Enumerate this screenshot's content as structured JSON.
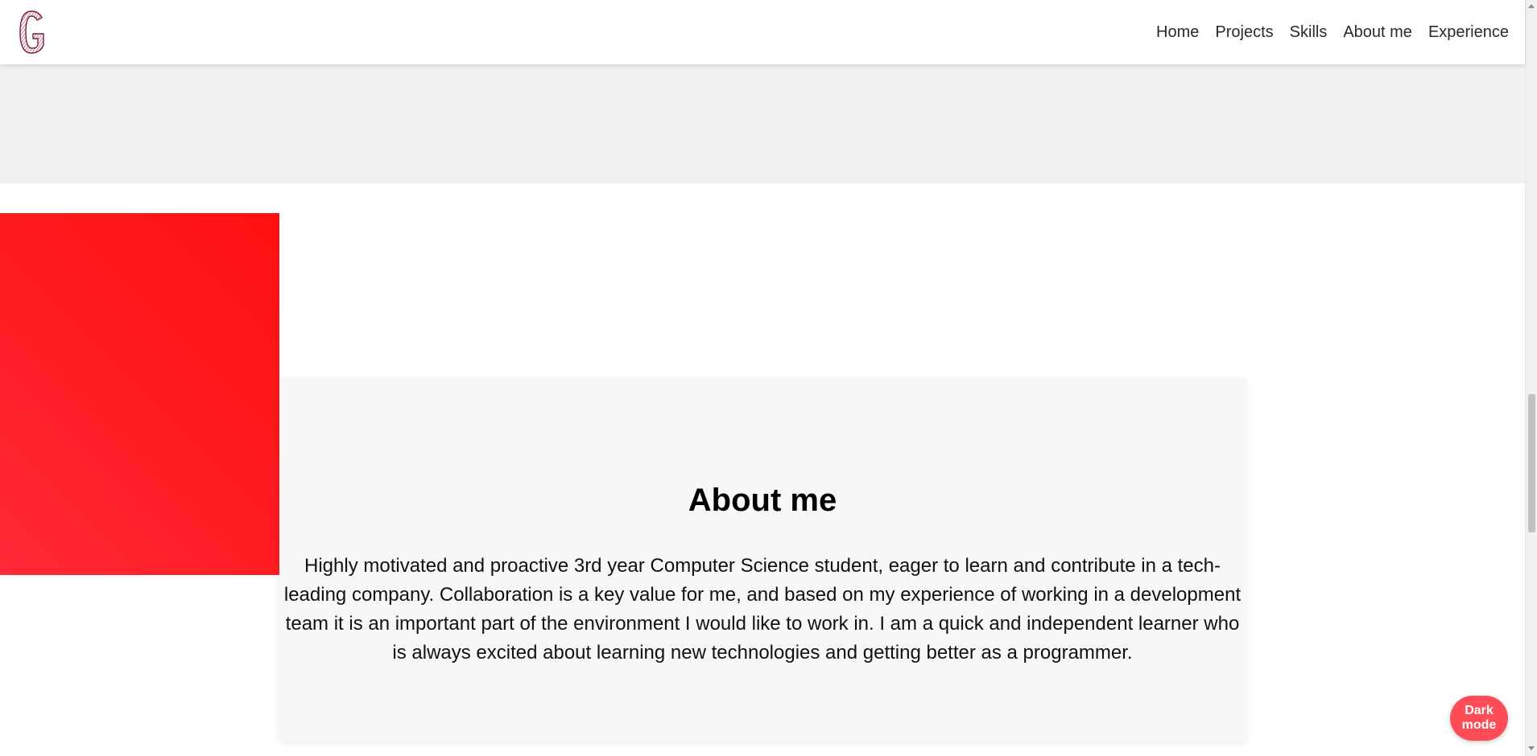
{
  "header": {
    "logo_letter": "G",
    "nav": [
      {
        "label": "Home"
      },
      {
        "label": "Projects"
      },
      {
        "label": "Skills"
      },
      {
        "label": "About me"
      },
      {
        "label": "Experience"
      }
    ]
  },
  "about": {
    "title": "About me",
    "text": "Highly motivated and proactive 3rd year Computer Science student, eager to learn and contribute in a tech-leading company. Collaboration is a key value for me, and based on my experience of working in a development team it is an important part of the environment I would like to work in. I am a quick and independent learner who is always excited about learning new technologies and getting better as a programmer."
  },
  "dark_mode_button": {
    "label": "Dark mode"
  },
  "colors": {
    "accent_red": "#ff1010",
    "dark_button": "#ff4d58",
    "logo_color": "#a8324a"
  }
}
